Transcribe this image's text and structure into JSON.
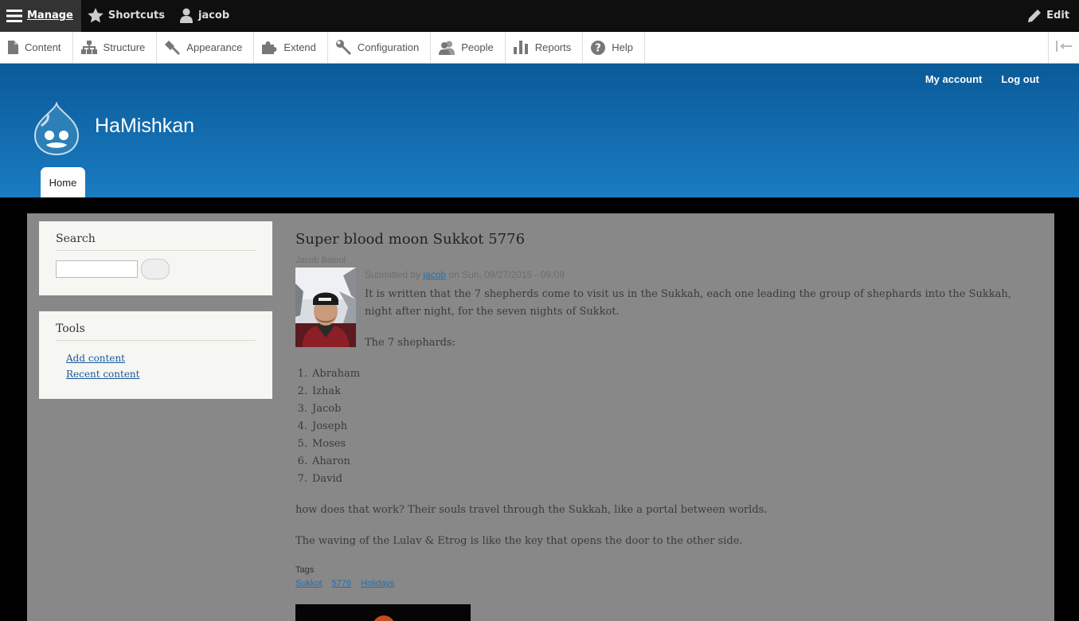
{
  "toolbar": {
    "manage": "Manage",
    "shortcuts": "Shortcuts",
    "user": "jacob",
    "edit": "Edit"
  },
  "tray": {
    "items": [
      {
        "label": "Content",
        "icon": "file-icon"
      },
      {
        "label": "Structure",
        "icon": "sitemap-icon"
      },
      {
        "label": "Appearance",
        "icon": "paintbrush-icon"
      },
      {
        "label": "Extend",
        "icon": "puzzle-icon"
      },
      {
        "label": "Configuration",
        "icon": "wrench-icon"
      },
      {
        "label": "People",
        "icon": "people-icon"
      },
      {
        "label": "Reports",
        "icon": "bar-chart-icon"
      },
      {
        "label": "Help",
        "icon": "help-icon"
      }
    ]
  },
  "header": {
    "my_account": "My account",
    "log_out": "Log out",
    "site_name": "HaMishkan",
    "tab_home": "Home",
    "colors": {
      "gradient_top": "#0a5a98",
      "gradient_bottom": "#1a7cc2"
    }
  },
  "sidebar": {
    "search_title": "Search",
    "tools_title": "Tools",
    "tools_links": [
      "Add content",
      "Recent content"
    ]
  },
  "article": {
    "title": "Super blood moon Sukkot 5776",
    "author_name": "Jacob Baloul",
    "submitted_prefix": "Submitted by",
    "submitted_user": "jacob",
    "submitted_suffix": "on Sun, 09/27/2015 - 09:09",
    "intro": "It is written that the 7 shepherds come to visit us in the Sukkah, each one leading the group of shephards into the Sukkah, night after night, for the seven nights of Sukkot.",
    "shepherds_heading": "The 7 shephards:",
    "shepherds": [
      "Abraham",
      "Izhak",
      "Jacob",
      "Joseph",
      "Moses",
      "Aharon",
      "David"
    ],
    "para2": "how does that work? Their souls travel through the Sukkah, like a portal between worlds.",
    "para3": "The waving of the Lulav & Etrog is like the key that opens the door to the other side.",
    "tags_label": "Tags",
    "tags": [
      "Sukkot",
      "5776",
      "Holidays"
    ]
  }
}
